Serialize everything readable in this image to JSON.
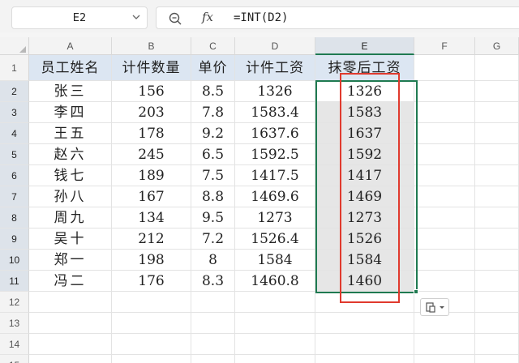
{
  "name_box": {
    "value": "E2"
  },
  "formula_bar": {
    "formula": "=INT(D2)",
    "fx_label": "fx"
  },
  "columns": [
    "A",
    "B",
    "C",
    "D",
    "E",
    "F",
    "G"
  ],
  "selected_column": "E",
  "row_numbers": [
    "1",
    "2",
    "3",
    "4",
    "5",
    "6",
    "7",
    "8",
    "9",
    "10",
    "11",
    "12",
    "13",
    "14",
    "15"
  ],
  "selected_rows": [
    "2",
    "3",
    "4",
    "5",
    "6",
    "7",
    "8",
    "9",
    "10",
    "11"
  ],
  "table": {
    "headers": [
      "员工姓名",
      "计件数量",
      "单价",
      "计件工资",
      "抹零后工资"
    ],
    "rows": [
      [
        "张三",
        "156",
        "8.5",
        "1326",
        "1326"
      ],
      [
        "李四",
        "203",
        "7.8",
        "1583.4",
        "1583"
      ],
      [
        "王五",
        "178",
        "9.2",
        "1637.6",
        "1637"
      ],
      [
        "赵六",
        "245",
        "6.5",
        "1592.5",
        "1592"
      ],
      [
        "钱七",
        "189",
        "7.5",
        "1417.5",
        "1417"
      ],
      [
        "孙八",
        "167",
        "8.8",
        "1469.6",
        "1469"
      ],
      [
        "周九",
        "134",
        "9.5",
        "1273",
        "1273"
      ],
      [
        "吴十",
        "212",
        "7.2",
        "1526.4",
        "1526"
      ],
      [
        "郑一",
        "198",
        "8",
        "1584",
        "1584"
      ],
      [
        "冯二",
        "176",
        "8.3",
        "1460.8",
        "1460"
      ]
    ]
  },
  "colors": {
    "selection": "#1f7a51",
    "highlight": "#e03a2e",
    "header_fill": "#dce6f2"
  }
}
